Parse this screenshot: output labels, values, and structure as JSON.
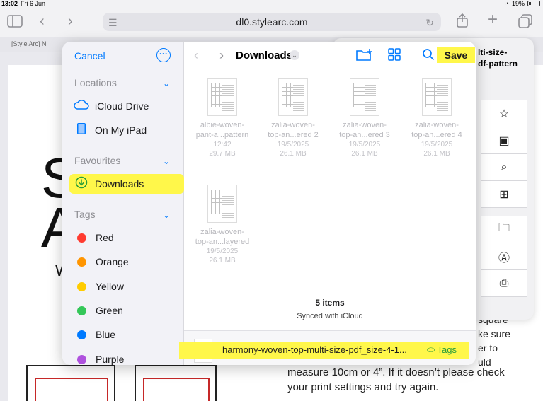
{
  "status_bar": {
    "time": "13:02",
    "date": "Fri 6 Jun",
    "battery": "19%"
  },
  "browser": {
    "url": "dl0.stylearc.com",
    "tab_title": "[Style Arc] N"
  },
  "background_page": {
    "letters": [
      "S",
      "A",
      "W"
    ],
    "paragraph_lines": [
      "measure 10cm or 4”. If it doesn’t please check",
      "your print settings and try again."
    ],
    "right_fragments": [
      "square",
      "ke sure",
      "er to",
      "uld"
    ]
  },
  "share_sheet": {
    "title_line1": "lti-size-",
    "title_line2": "df-pattern"
  },
  "dialog": {
    "cancel_label": "Cancel",
    "sidebar": {
      "locations_header": "Locations",
      "locations": [
        {
          "label": "iCloud Drive",
          "icon": "cloud-icon"
        },
        {
          "label": "On My iPad",
          "icon": "ipad-icon"
        }
      ],
      "favourites_header": "Favourites",
      "favourites": [
        {
          "label": "Downloads",
          "icon": "download-circle-icon",
          "active": true
        }
      ],
      "tags_header": "Tags",
      "tags": [
        {
          "label": "Red",
          "color": "#ff3b30"
        },
        {
          "label": "Orange",
          "color": "#ff9500"
        },
        {
          "label": "Yellow",
          "color": "#ffcc00"
        },
        {
          "label": "Green",
          "color": "#34c759"
        },
        {
          "label": "Blue",
          "color": "#007aff"
        },
        {
          "label": "Purple",
          "color": "#af52de"
        }
      ]
    },
    "content": {
      "folder_title": "Downloads",
      "save_label": "Save",
      "files": [
        {
          "name1": "albie-woven-",
          "name2": "pant-a...pattern",
          "date": "12:42",
          "size": "29.7 MB"
        },
        {
          "name1": "zalia-woven-",
          "name2": "top-an...ered 2",
          "date": "19/5/2025",
          "size": "26.1 MB"
        },
        {
          "name1": "zalia-woven-",
          "name2": "top-an...ered 3",
          "date": "19/5/2025",
          "size": "26.1 MB"
        },
        {
          "name1": "zalia-woven-",
          "name2": "top-an...ered 4",
          "date": "19/5/2025",
          "size": "26.1 MB"
        },
        {
          "name1": "zalia-woven-",
          "name2": "top-an...layered",
          "date": "19/5/2025",
          "size": "26.1 MB"
        }
      ],
      "items_count": "5 items",
      "synced_text": "Synced with iCloud",
      "filename": "harmony-woven-top-multi-size-pdf_size-4-1...",
      "tags_label": "Tags"
    }
  },
  "colors": {
    "accent": "#007aff",
    "highlight": "#fff74a",
    "tags_green": "#2a9d3a"
  }
}
